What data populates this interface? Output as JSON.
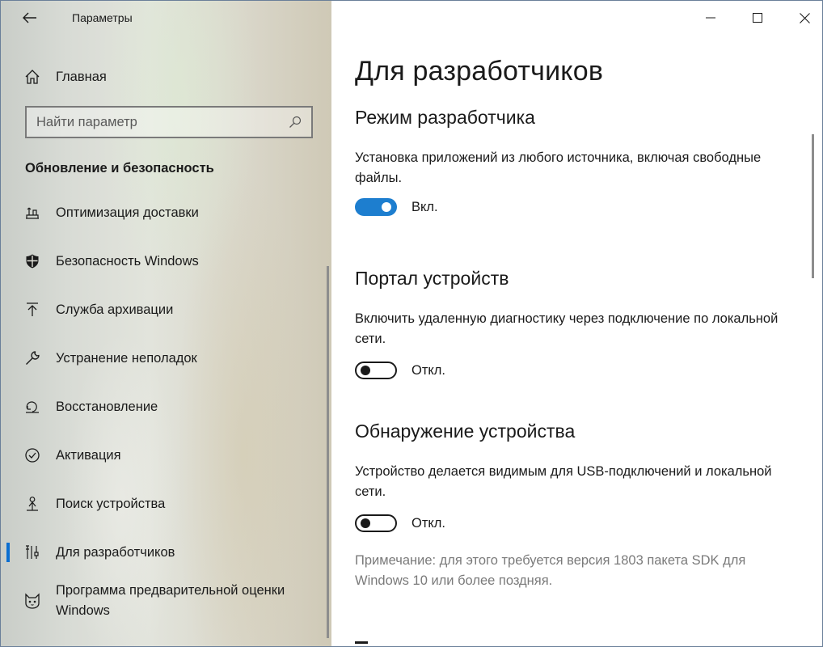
{
  "window": {
    "title": "Параметры"
  },
  "sidebar": {
    "home_label": "Главная",
    "search": {
      "placeholder": "Найти параметр"
    },
    "section_header": "Обновление и безопасность",
    "items": [
      {
        "label": "Оптимизация доставки",
        "icon": "delivery-optimization-icon"
      },
      {
        "label": "Безопасность Windows",
        "icon": "shield-icon"
      },
      {
        "label": "Служба архивации",
        "icon": "backup-arrow-icon"
      },
      {
        "label": "Устранение неполадок",
        "icon": "wrench-icon"
      },
      {
        "label": "Восстановление",
        "icon": "recovery-icon"
      },
      {
        "label": "Активация",
        "icon": "check-circle-icon"
      },
      {
        "label": "Поиск устройства",
        "icon": "person-location-icon"
      },
      {
        "label": "Для разработчиков",
        "icon": "developer-tools-icon",
        "selected": true
      },
      {
        "label": "Программа предварительной оценки Windows",
        "icon": "insider-cat-icon"
      }
    ]
  },
  "content": {
    "page_title": "Для разработчиков",
    "settings": [
      {
        "heading": "Режим разработчика",
        "description": "Установка приложений из любого источника, включая свободные файлы.",
        "state_label": "Вкл.",
        "on": true
      },
      {
        "heading": "Портал устройств",
        "description": "Включить удаленную диагностику через подключение по локальной сети.",
        "state_label": "Откл.",
        "on": false
      },
      {
        "heading": "Обнаружение устройства",
        "description": "Устройство делается видимым для USB-подключений и локальной сети.",
        "state_label": "Откл.",
        "on": false
      }
    ],
    "note": "Примечание: для этого требуется версия 1803 пакета SDK для Windows 10 или более поздняя."
  },
  "colors": {
    "accent": "#1d7ecf",
    "selection_bar": "#0a6ed1",
    "note_text": "#7a7a7a"
  }
}
